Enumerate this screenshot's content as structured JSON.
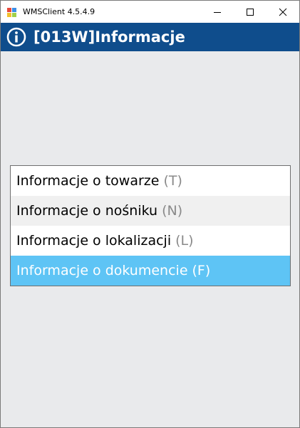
{
  "window": {
    "title": "WMSClient 4.5.4.9"
  },
  "header": {
    "title": "[013W]Informacje",
    "icon": "info-circle-icon"
  },
  "menu": {
    "items": [
      {
        "label": "Informacje o towarze",
        "key": "(T)",
        "selected": false
      },
      {
        "label": "Informacje o nośniku",
        "key": "(N)",
        "selected": false
      },
      {
        "label": "Informacje o lokalizacji",
        "key": "(L)",
        "selected": false
      },
      {
        "label": "Informacje o dokumencie",
        "key": "(F)",
        "selected": true
      }
    ]
  },
  "colors": {
    "header_bg": "#0f4d8c",
    "selected_bg": "#5ec4f5",
    "body_bg": "#e9eaec",
    "key_text": "#8a8a8a"
  }
}
